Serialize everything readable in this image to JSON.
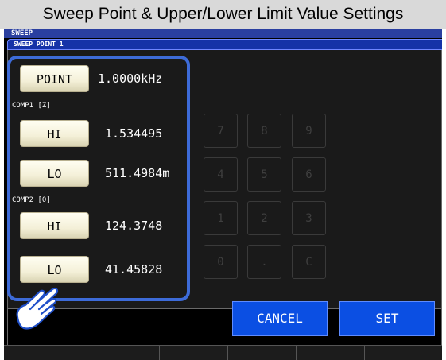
{
  "caption": "Sweep Point & Upper/Lower Limit Value Settings",
  "window_title": "SWEEP",
  "sub_title": "SWEEP POINT 1",
  "point": {
    "label": "POINT",
    "value": "1.0000kHz"
  },
  "comp1": {
    "label": "COMP1 [Z]",
    "hi": {
      "label": "HI",
      "value": "1.534495"
    },
    "lo": {
      "label": "LO",
      "value": "511.4984m"
    }
  },
  "comp2": {
    "label": "COMP2 [θ]",
    "hi": {
      "label": "HI",
      "value": "124.3748"
    },
    "lo": {
      "label": "LO",
      "value": "41.45828"
    }
  },
  "keypad": {
    "row1": [
      "7",
      "8",
      "9"
    ],
    "row2": [
      "4",
      "5",
      "6"
    ],
    "row3": [
      "1",
      "2",
      "3"
    ],
    "row4": [
      "0",
      ".",
      "C"
    ]
  },
  "actions": {
    "cancel": "CANCEL",
    "set": "SET"
  },
  "colors": {
    "accent_blue": "#0b4fe3",
    "highlight": "#3d6bd8",
    "button_cream": "#f4f0d8"
  },
  "icons": {
    "pointer": "hand-pointer-icon"
  }
}
